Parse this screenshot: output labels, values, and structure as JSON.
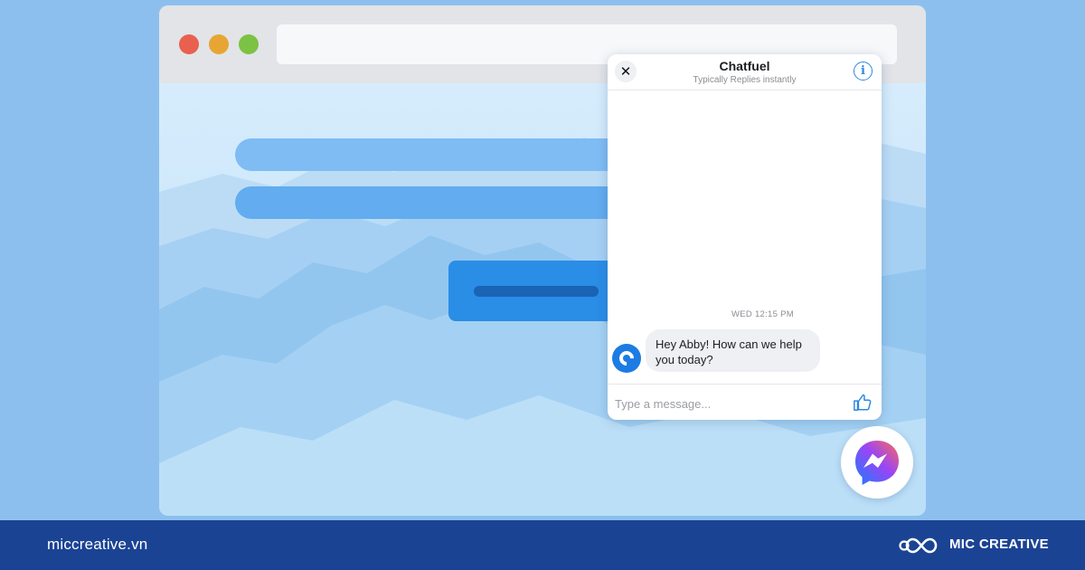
{
  "chat": {
    "title": "Chatfuel",
    "subtitle": "Typically Replies instantly",
    "timestamp": "WED 12:15 PM",
    "message": "Hey Abby! How can we help you today?",
    "composer_placeholder": "Type a message..."
  },
  "icons": {
    "close": "close-icon",
    "info": "info-icon",
    "like": "thumbs-up-icon",
    "messenger": "messenger-icon",
    "bot_avatar": "chatfuel-logo"
  },
  "window_controls": [
    "close",
    "minimize",
    "maximize"
  ],
  "footer": {
    "url": "miccreative.vn",
    "brand": "MIC CREATIVE"
  },
  "colors": {
    "background": "#8dbfee",
    "accent": "#2d88e0",
    "footer": "#1b4394"
  }
}
